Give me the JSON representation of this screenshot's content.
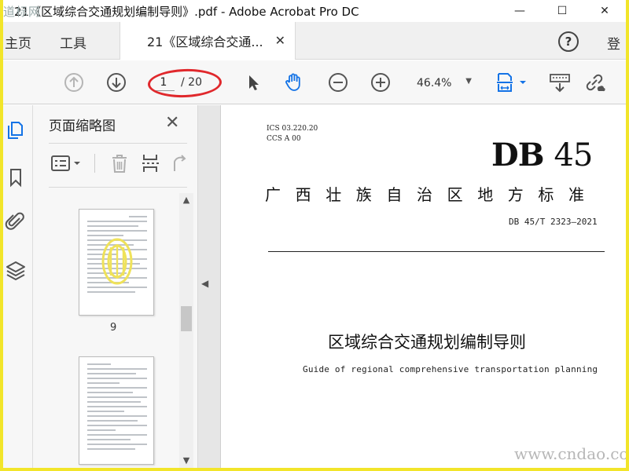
{
  "window": {
    "title": "21《区域综合交通规划编制导则》.pdf - Adobe Acrobat Pro DC",
    "watermark_top": "道标网"
  },
  "tabs": {
    "home": "主页",
    "tools": "工具",
    "document": "21《区域综合交通...",
    "login": "登"
  },
  "toolbar": {
    "current_page": "1",
    "total_pages": "/ 20",
    "zoom": "46.4%"
  },
  "thumbnails_panel": {
    "title": "页面缩略图",
    "thumbs": [
      {
        "label": "9"
      },
      {
        "label": ""
      }
    ]
  },
  "document": {
    "ics": "ICS  03.220.20",
    "ccs": "CCS A 00",
    "db_prefix": "DB",
    "db_number": "45",
    "province": "广西壮族自治区地方标准",
    "standard_no": "DB 45/T 2323—2021",
    "title_cn": "区域综合交通规划编制导则",
    "title_en": "Guide of regional comprehensive transportation planning"
  },
  "watermark_bottom": "www.cndao.com",
  "colors": {
    "accent_blue": "#1473e6",
    "annotation_red": "#e0282c",
    "frame_yellow": "#f2e52a"
  }
}
